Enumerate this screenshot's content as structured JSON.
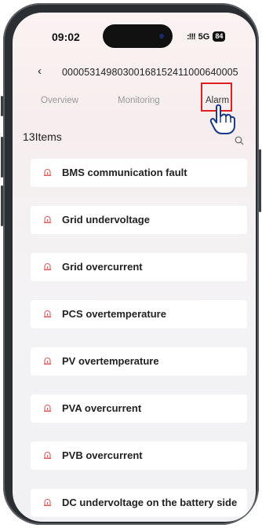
{
  "status_bar": {
    "time": "09:02",
    "signal": ":!!!",
    "network": "5G",
    "battery": "84"
  },
  "header": {
    "device_id": "000053149803001681524110006400​05"
  },
  "tabs": [
    {
      "label": "Overview"
    },
    {
      "label": "Monitoring"
    },
    {
      "label": "Alarm"
    }
  ],
  "count_label": "13Items",
  "alarms": [
    {
      "label": "BMS communication fault"
    },
    {
      "label": "Grid undervoltage"
    },
    {
      "label": "Grid overcurrent"
    },
    {
      "label": "PCS overtemperature"
    },
    {
      "label": "PV overtemperature"
    },
    {
      "label": "PVA overcurrent"
    },
    {
      "label": "PVB overcurrent"
    },
    {
      "label": "DC undervoltage on the battery side"
    }
  ],
  "colors": {
    "highlight": "#e02020",
    "alarm_icon": "#e05a5a",
    "tab_inactive": "#9a9a9a"
  }
}
